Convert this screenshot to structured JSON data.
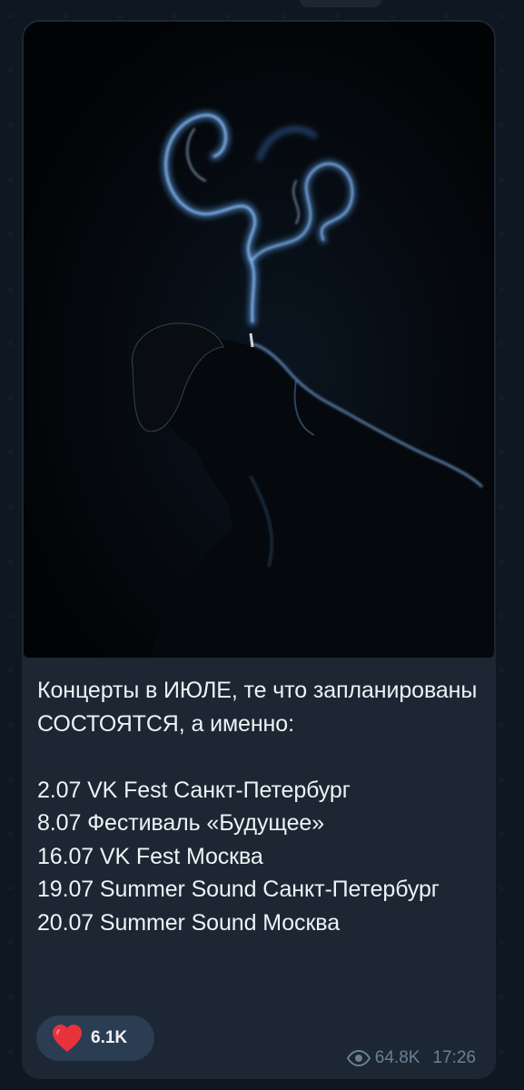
{
  "post": {
    "text": "Концерты в ИЮЛЕ, те что запланированы СОСТОЯТСЯ, а именно:\n\n2.07 VK Fest Санкт-Петербург\n8.07 Фестиваль «Будущее»\n16.07 VK Fest Москва\n19.07 Summer Sound Санкт-Петербург\n20.07 Summer Sound Москва",
    "reaction": {
      "icon": "heart-icon",
      "count": "6.1K"
    },
    "views": "64.8K",
    "time": "17:26",
    "views_icon": "eye-icon"
  },
  "colors": {
    "background": "#0f1822",
    "bubble": "#1c2733",
    "reaction_pill": "#2a3d52",
    "heart": "#e8323c",
    "meta_text": "#6b7f93",
    "text": "#eef2f6"
  }
}
